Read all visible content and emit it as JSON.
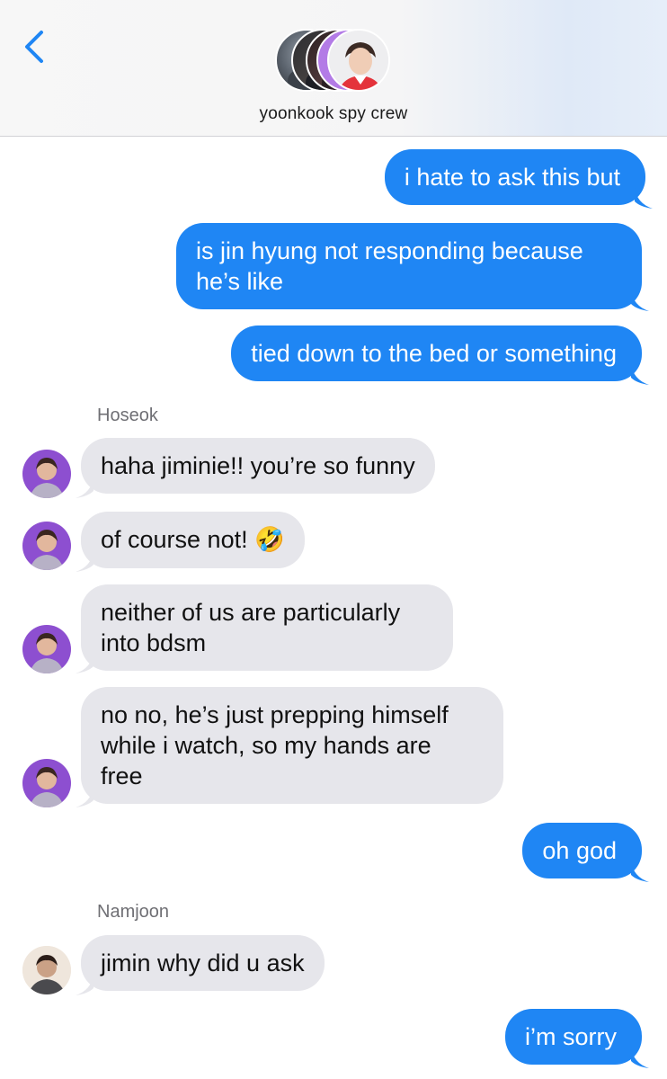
{
  "header": {
    "group_name": "yoonkook spy crew",
    "back_icon": "chevron-left-icon"
  },
  "messages": [
    {
      "direction": "outgoing",
      "text": "i hate to ask this but"
    },
    {
      "direction": "outgoing",
      "lines": [
        "is jin hyung not responding because",
        "he’s like"
      ]
    },
    {
      "direction": "outgoing",
      "text": "tied down to the bed or something"
    },
    {
      "sender_label": "Hoseok"
    },
    {
      "direction": "incoming",
      "sender": "Hoseok",
      "text": "haha jiminie!! you’re so funny"
    },
    {
      "direction": "incoming",
      "sender": "Hoseok",
      "text": "of course not!",
      "emoji": "🤣"
    },
    {
      "direction": "incoming",
      "sender": "Hoseok",
      "lines": [
        "neither of us are particularly",
        "into bdsm"
      ]
    },
    {
      "direction": "incoming",
      "sender": "Hoseok",
      "lines": [
        "no no, he’s just prepping himself",
        "while i watch, so my hands are",
        "free"
      ]
    },
    {
      "direction": "outgoing",
      "text": "oh god"
    },
    {
      "sender_label": "Namjoon"
    },
    {
      "direction": "incoming",
      "sender": "Namjoon",
      "text": "jimin why did u ask"
    },
    {
      "direction": "outgoing",
      "text": "i’m sorry"
    }
  ],
  "colors": {
    "outgoing_bubble": "#1f86f4",
    "incoming_bubble": "#e6e6eb",
    "accent": "#1f86f4"
  }
}
